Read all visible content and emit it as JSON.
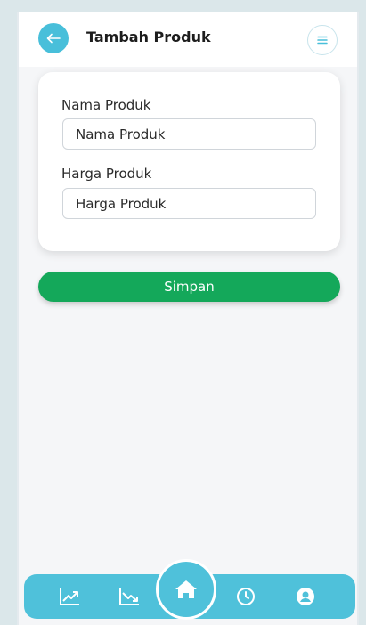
{
  "header": {
    "title": "Tambah Produk",
    "back_icon": "arrow-left-icon",
    "menu_icon": "menu-icon"
  },
  "form": {
    "name_label": "Nama Produk",
    "name_placeholder": "Nama Produk",
    "name_value": "",
    "price_label": "Harga Produk",
    "price_placeholder": "Harga Produk",
    "price_value": ""
  },
  "actions": {
    "save_label": "Simpan"
  },
  "bottom_nav": {
    "items": [
      {
        "icon": "chart-up-icon"
      },
      {
        "icon": "chart-down-icon"
      },
      {
        "icon": "home-icon"
      },
      {
        "icon": "clock-icon"
      },
      {
        "icon": "profile-icon"
      }
    ]
  },
  "colors": {
    "accent": "#48bfda",
    "nav_background": "#4fc1da",
    "save_button": "#14a85a",
    "page_background": "#f5f6f8"
  }
}
